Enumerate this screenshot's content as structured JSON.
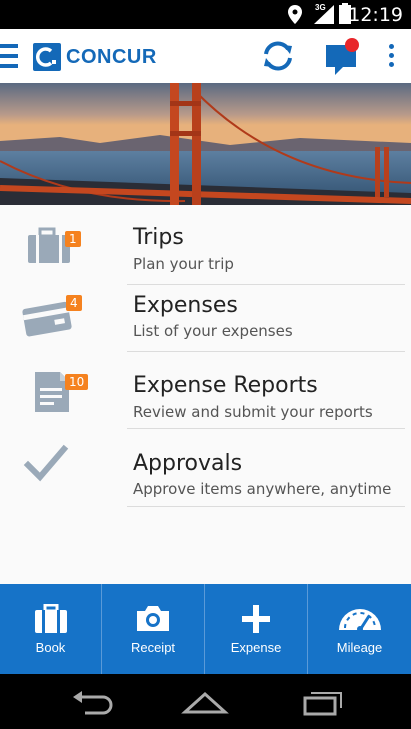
{
  "status_bar": {
    "time": "12:19",
    "network": "3G"
  },
  "app": {
    "brand": "CONCUR"
  },
  "menu": [
    {
      "title": "Trips",
      "subtitle": "Plan your trip",
      "badge": "1",
      "icon": "briefcase-icon"
    },
    {
      "title": "Expenses",
      "subtitle": "List of your expenses",
      "badge": "4",
      "icon": "credit-card-icon"
    },
    {
      "title": "Expense Reports",
      "subtitle": "Review and submit your reports",
      "badge": "10",
      "icon": "report-icon"
    },
    {
      "title": "Approvals",
      "subtitle": "Approve items anywhere, anytime",
      "badge": "",
      "icon": "checkmark-icon"
    }
  ],
  "bottom_nav": [
    {
      "label": "Book",
      "icon": "briefcase-icon"
    },
    {
      "label": "Receipt",
      "icon": "camera-icon"
    },
    {
      "label": "Expense",
      "icon": "plus-icon"
    },
    {
      "label": "Mileage",
      "icon": "speedometer-icon"
    }
  ],
  "colors": {
    "brand": "#1469b8",
    "badge": "#f5821f",
    "bottom_nav": "#1673c8",
    "notification": "#e8262b"
  }
}
